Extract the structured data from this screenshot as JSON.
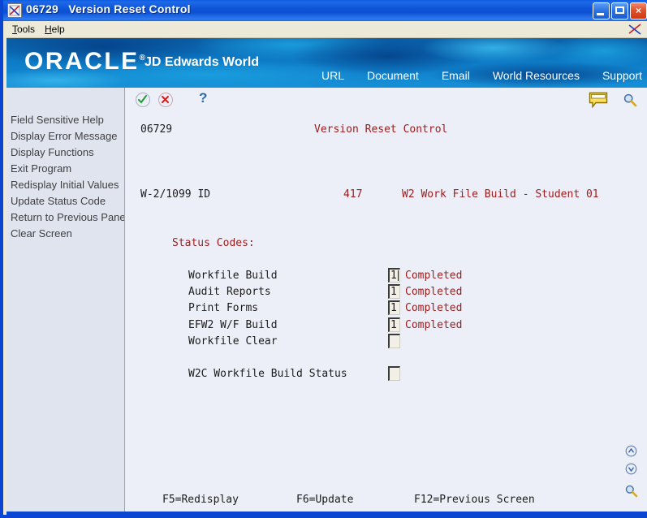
{
  "window": {
    "program_id": "06729",
    "title": "Version Reset Control",
    "icon": "jde-app-icon",
    "buttons": {
      "minimize": "minimize-button",
      "maximize": "maximize-button",
      "close": "×"
    }
  },
  "menubar": {
    "items": [
      {
        "label": "Tools",
        "mnemonic": "T"
      },
      {
        "label": "Help",
        "mnemonic": "H"
      }
    ],
    "logo_icon": "jde-swoosh-icon"
  },
  "banner": {
    "brand": "ORACLE",
    "brand_mark": "®",
    "product": "JD Edwards World",
    "nav": [
      {
        "label": "URL"
      },
      {
        "label": "Document"
      },
      {
        "label": "Email"
      },
      {
        "label": "World Resources"
      },
      {
        "label": "Support"
      }
    ]
  },
  "toolbar": {
    "ok_icon": "green-check-icon",
    "cancel_icon": "red-x-icon",
    "help_label": "?",
    "note_icon": "note-bubble-icon",
    "search_icon": "magnifier-icon"
  },
  "sidebar": {
    "items": [
      {
        "label": "Field Sensitive Help"
      },
      {
        "label": "Display Error Message"
      },
      {
        "label": "Display Functions"
      },
      {
        "label": "Exit Program"
      },
      {
        "label": "Redisplay Initial Values"
      },
      {
        "label": "Update Status Code"
      },
      {
        "label": "Return to Previous Panel"
      },
      {
        "label": "Clear Screen"
      }
    ]
  },
  "form": {
    "screen_id": "06729",
    "screen_title": "Version Reset Control",
    "id_label": "W-2/1099 ID",
    "id_value": "417",
    "id_description": "W2 Work File Build - Student 01",
    "section_heading": "Status Codes:",
    "status_rows": [
      {
        "label": "Workfile Build",
        "value": "1",
        "status": "Completed",
        "focused": true
      },
      {
        "label": "Audit Reports",
        "value": "1",
        "status": "Completed",
        "focused": false
      },
      {
        "label": "Print Forms",
        "value": "1",
        "status": "Completed",
        "focused": false
      },
      {
        "label": "EFW2 W/F Build",
        "value": "1",
        "status": "Completed",
        "focused": false
      },
      {
        "label": "Workfile Clear",
        "value": "",
        "status": "",
        "focused": false
      }
    ],
    "w2c_row": {
      "label": "W2C Workfile Build Status",
      "value": ""
    }
  },
  "footer": {
    "fkeys": [
      {
        "label": "F5=Redisplay"
      },
      {
        "label": "F6=Update"
      },
      {
        "label": "F12=Previous Screen"
      }
    ]
  },
  "page_nav": {
    "up_icon": "page-up-icon",
    "down_icon": "page-down-icon",
    "search_icon": "magnifier-icon"
  },
  "colors": {
    "title_blue": "#0a46d2",
    "screen_red": "#9e1b1b",
    "banner_blue": "#0b72c0",
    "panel_bg": "#eceff8",
    "sidebar_bg": "#e0e4ef"
  }
}
